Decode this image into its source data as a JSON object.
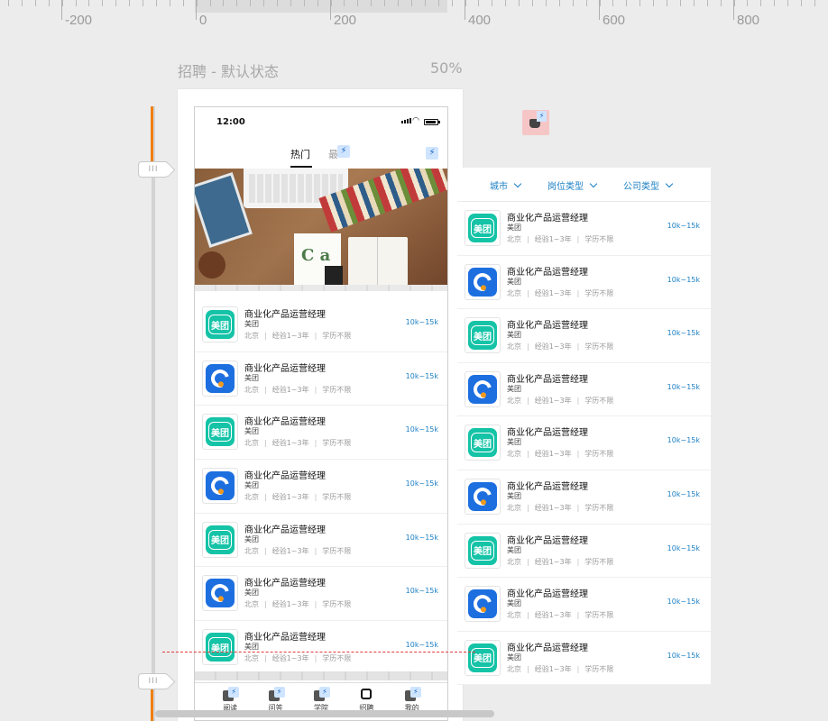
{
  "ruler": {
    "labels": [
      "-200",
      "0",
      "200",
      "400",
      "600",
      "800"
    ]
  },
  "artboard": {
    "title": "招聘 - 默认状态",
    "zoom": "50%"
  },
  "handle_label": "III",
  "phone": {
    "status": {
      "time": "12:00"
    },
    "tabs": {
      "hot": "热门",
      "latest_partial": "最"
    },
    "bolt_glyph": "⚡",
    "bottom_tabs": [
      {
        "label": "阅读",
        "icon": "read-icon"
      },
      {
        "label": "问答",
        "icon": "qa-icon"
      },
      {
        "label": "学院",
        "icon": "academy-icon"
      },
      {
        "label": "招聘",
        "icon": "search-icon"
      },
      {
        "label": "我的",
        "icon": "profile-icon"
      }
    ]
  },
  "job_template": {
    "title": "商业化产品运营经理",
    "company": "美团",
    "city": "北京",
    "experience": "经验1~3年",
    "education": "学历不限",
    "salary": "10k~15k",
    "separator": "|"
  },
  "phone_jobs": [
    {
      "logo": "meituan"
    },
    {
      "logo": "ctrip"
    },
    {
      "logo": "meituan"
    },
    {
      "logo": "ctrip"
    },
    {
      "logo": "meituan"
    },
    {
      "logo": "ctrip"
    },
    {
      "logo": "meituan"
    }
  ],
  "panel": {
    "filters": [
      "城市",
      "岗位类型",
      "公司类型"
    ],
    "jobs": [
      {
        "logo": "meituan"
      },
      {
        "logo": "ctrip"
      },
      {
        "logo": "meituan"
      },
      {
        "logo": "ctrip"
      },
      {
        "logo": "meituan"
      },
      {
        "logo": "ctrip"
      },
      {
        "logo": "meituan"
      },
      {
        "logo": "ctrip"
      },
      {
        "logo": "meituan"
      }
    ]
  },
  "logo_text": {
    "meituan": "美团"
  },
  "colors": {
    "accent_blue": "#1b7fc4",
    "meituan_green": "#15c3a7",
    "ctrip_blue": "#1d6fe0",
    "timeline_orange": "#f08010",
    "guide_red": "#e23b3b"
  }
}
